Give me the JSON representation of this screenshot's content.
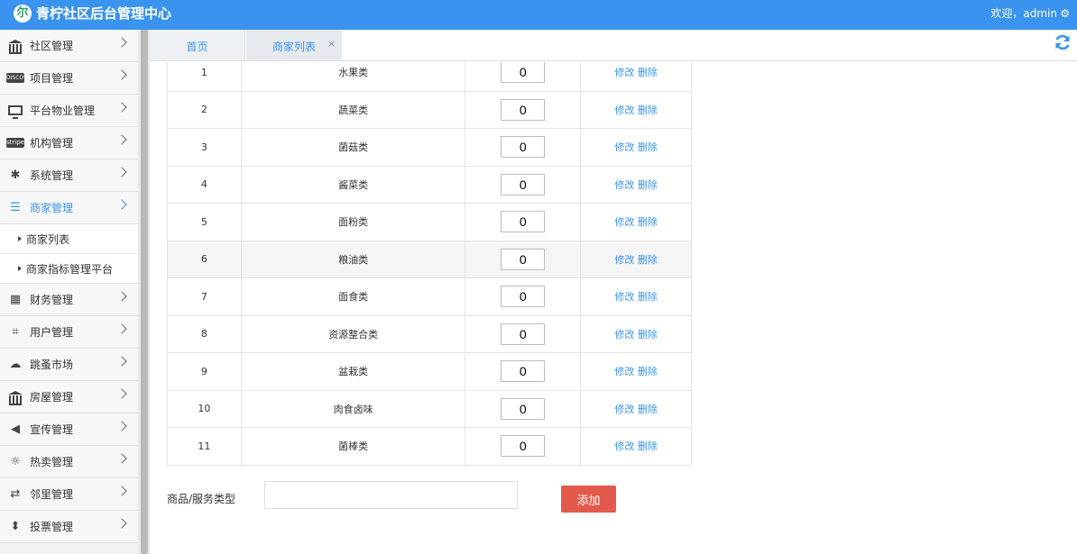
{
  "header": {
    "logo_glyph": "尔",
    "title": "青柠社区后台管理中心",
    "welcome": "欢迎，admin"
  },
  "sidebar": {
    "items": [
      {
        "label": "社区管理",
        "icon": "bank-icon"
      },
      {
        "label": "项目管理",
        "icon": "discover-badge-icon",
        "badge_text": "DISCOVER"
      },
      {
        "label": "平台物业管理",
        "icon": "monitor-icon"
      },
      {
        "label": "机构管理",
        "icon": "stripe-badge-icon",
        "badge_text": "stripe"
      },
      {
        "label": "系统管理",
        "icon": "yelp-icon"
      },
      {
        "label": "商家管理",
        "icon": "list-icon",
        "active": true
      }
    ],
    "sub_items": [
      {
        "label": "商家列表"
      },
      {
        "label": "商家指标管理平台"
      }
    ],
    "items_after": [
      {
        "label": "财务管理",
        "icon": "calculator-icon"
      },
      {
        "label": "用户管理",
        "icon": "crop-icon"
      },
      {
        "label": "跳蚤市场",
        "icon": "cloud-icon"
      },
      {
        "label": "房屋管理",
        "icon": "bank-icon"
      },
      {
        "label": "宣传管理",
        "icon": "volume-icon"
      },
      {
        "label": "热卖管理",
        "icon": "sun-icon"
      },
      {
        "label": "邻里管理",
        "icon": "retweet-icon"
      },
      {
        "label": "投票管理",
        "icon": "sort-icon"
      }
    ]
  },
  "tabs": [
    {
      "label": "首页"
    },
    {
      "label": "商家列表",
      "close": "×"
    }
  ],
  "table": {
    "edit_label": "修改",
    "delete_label": "删除",
    "highlighted_row": 6,
    "rows": [
      {
        "index": "1",
        "name": "水果类",
        "sort": "0"
      },
      {
        "index": "2",
        "name": "蔬菜类",
        "sort": "0"
      },
      {
        "index": "3",
        "name": "菌菇类",
        "sort": "0"
      },
      {
        "index": "4",
        "name": "酱菜类",
        "sort": "0"
      },
      {
        "index": "5",
        "name": "面粉类",
        "sort": "0"
      },
      {
        "index": "6",
        "name": "粮油类",
        "sort": "0"
      },
      {
        "index": "7",
        "name": "面食类",
        "sort": "0"
      },
      {
        "index": "8",
        "name": "资源整合类",
        "sort": "0"
      },
      {
        "index": "9",
        "name": "盆栽类",
        "sort": "0"
      },
      {
        "index": "10",
        "name": "肉食卤味",
        "sort": "0"
      },
      {
        "index": "11",
        "name": "菌棒类",
        "sort": "0"
      }
    ]
  },
  "form": {
    "label": "商品/服务类型",
    "value": "",
    "add_label": "添加"
  },
  "colors": {
    "primary": "#3a93ee",
    "danger": "#e25a4c"
  }
}
